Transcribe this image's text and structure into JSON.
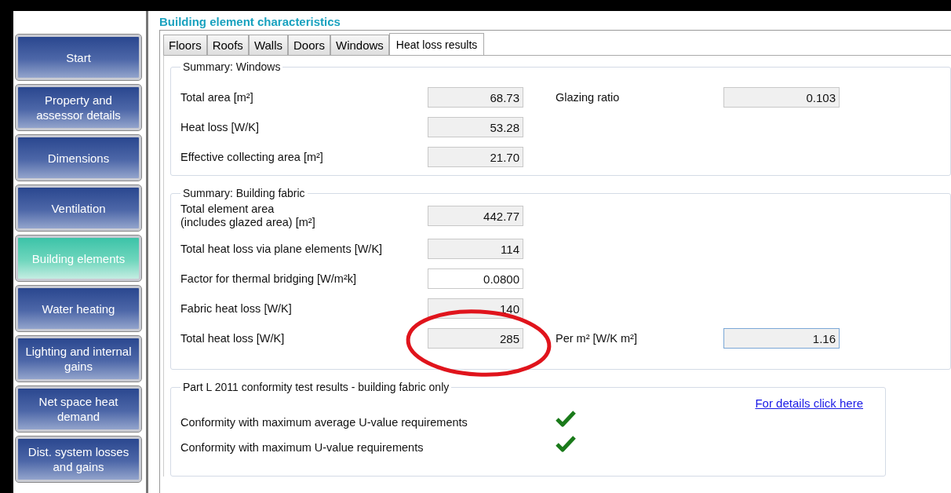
{
  "title": "Building element characteristics",
  "sidebar": {
    "items": [
      {
        "label": "Start",
        "selected": false
      },
      {
        "label": "Property and assessor details",
        "selected": false
      },
      {
        "label": "Dimensions",
        "selected": false
      },
      {
        "label": "Ventilation",
        "selected": false
      },
      {
        "label": "Building elements",
        "selected": true
      },
      {
        "label": "Water heating",
        "selected": false
      },
      {
        "label": "Lighting and internal gains",
        "selected": false
      },
      {
        "label": "Net space heat demand",
        "selected": false
      },
      {
        "label": "Dist. system losses and gains",
        "selected": false
      }
    ]
  },
  "tabs": [
    {
      "label": "Floors",
      "selected": false
    },
    {
      "label": "Roofs",
      "selected": false
    },
    {
      "label": "Walls",
      "selected": false
    },
    {
      "label": "Doors",
      "selected": false
    },
    {
      "label": "Windows",
      "selected": false
    },
    {
      "label": "Heat loss results",
      "selected": true
    }
  ],
  "windows_summary": {
    "title": "Summary: Windows",
    "rows": [
      {
        "label": "Total area [m²]",
        "value": "68.73",
        "editable": false,
        "annotated": false,
        "extra": {
          "label": "Glazing ratio",
          "value": "0.103",
          "focused": false
        }
      },
      {
        "label": "Heat loss [W/K]",
        "value": "53.28",
        "editable": false,
        "annotated": false
      },
      {
        "label": "Effective collecting area [m²]",
        "value": "21.70",
        "editable": false,
        "annotated": false
      }
    ]
  },
  "fabric_summary": {
    "title": "Summary: Building fabric",
    "rows": [
      {
        "label": "Total element area\n(includes glazed area) [m²]",
        "value": "442.77",
        "editable": false,
        "annotated": false
      },
      {
        "label": "Total heat loss via plane elements [W/K]",
        "value": "114",
        "editable": false,
        "annotated": false
      },
      {
        "label": "Factor for thermal bridging [W/m²k]",
        "value": "0.0800",
        "editable": true,
        "annotated": false
      },
      {
        "label": "Fabric heat loss [W/K]",
        "value": "140",
        "editable": false,
        "annotated": false
      },
      {
        "label": "Total heat loss [W/K]",
        "value": "285",
        "editable": false,
        "annotated": true,
        "extra": {
          "label": "Per m² [W/K m²]",
          "value": "1.16",
          "focused": true
        }
      }
    ]
  },
  "conformity": {
    "title": "Part L 2011 conformity test results - building fabric only",
    "link": "For details click here",
    "rows": [
      {
        "label": "Conformity with maximum average U-value requirements",
        "checked": true
      },
      {
        "label": "Conformity with maximum U-value requirements",
        "checked": true
      }
    ]
  }
}
